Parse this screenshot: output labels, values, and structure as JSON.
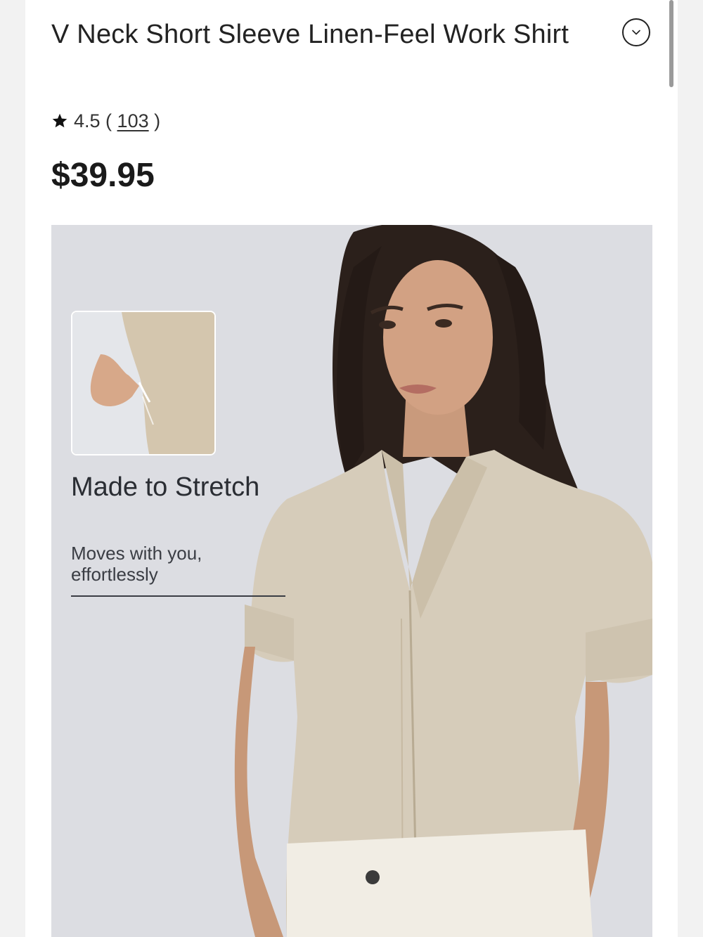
{
  "product": {
    "title": "V Neck Short Sleeve Linen-Feel Work Shirt",
    "rating": "4.5",
    "review_count": "103",
    "price": "$39.95"
  },
  "icons": {
    "rating": "star-icon",
    "collapse": "chevron-down-icon"
  },
  "hero": {
    "feature_title": "Made to Stretch",
    "feature_subtitle": "Moves with you, effortlessly"
  },
  "colors": {
    "page_background": "#f2f2f2",
    "card_background": "#ffffff",
    "hero_background": "#dcdde2",
    "shirt": "#d6ccba",
    "text": "#1a1a1a"
  }
}
